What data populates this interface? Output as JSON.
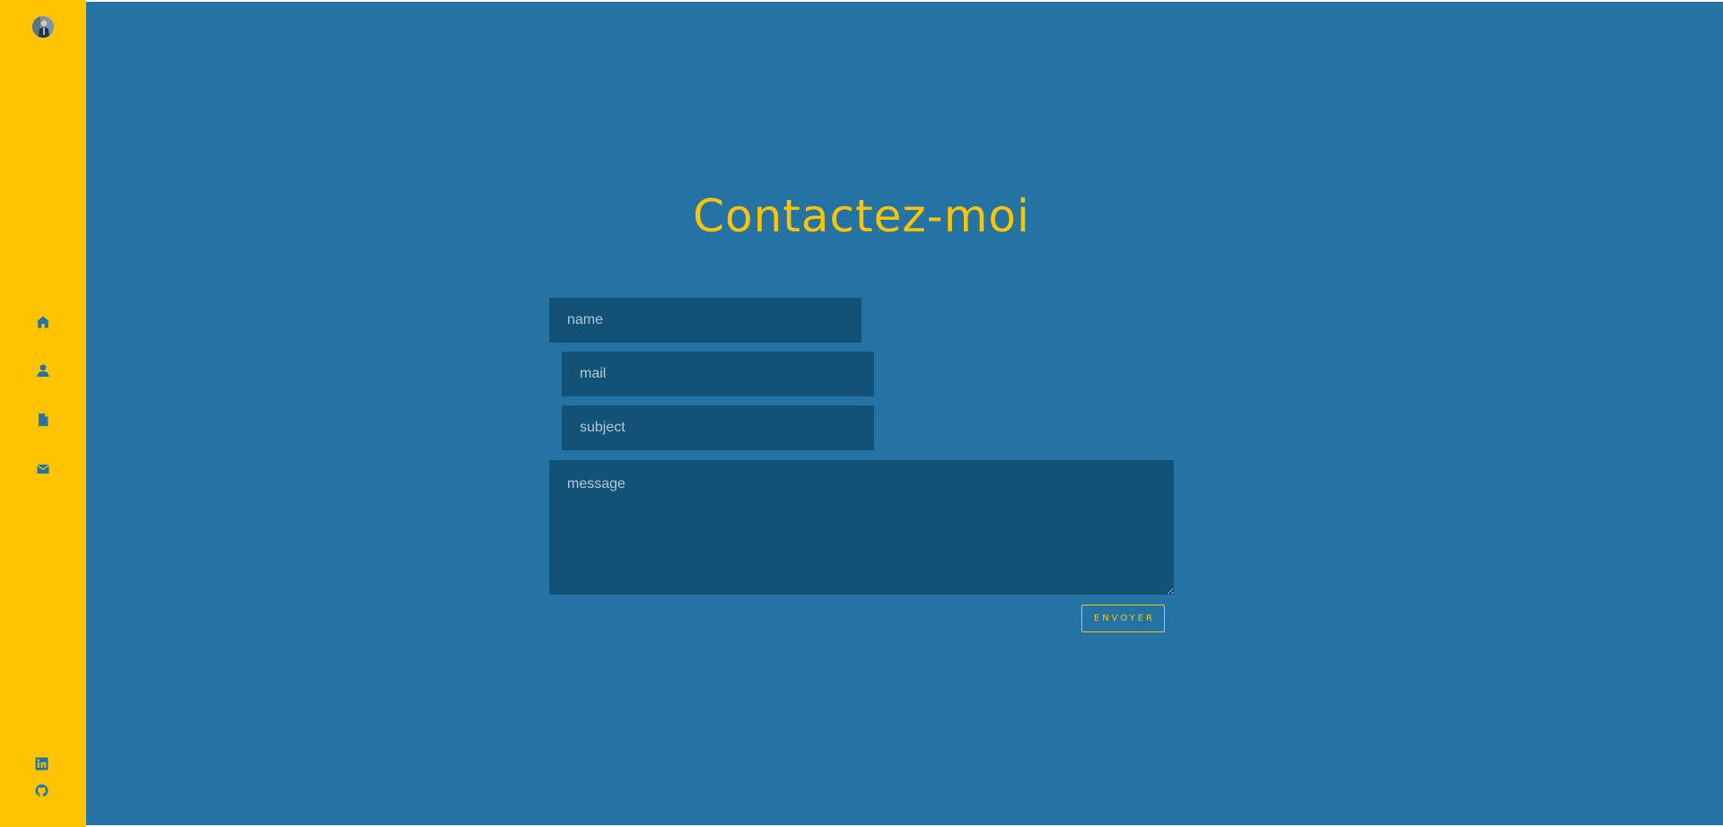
{
  "sidebar": {
    "avatar": "profile-photo",
    "nav": [
      {
        "name": "home",
        "icon": "home-icon"
      },
      {
        "name": "about",
        "icon": "user-icon"
      },
      {
        "name": "resume",
        "icon": "file-icon"
      },
      {
        "name": "contact",
        "icon": "envelope-icon"
      }
    ],
    "social": [
      {
        "name": "linkedin",
        "icon": "linkedin-icon"
      },
      {
        "name": "github",
        "icon": "github-icon"
      }
    ]
  },
  "main": {
    "title": "Contactez-moi",
    "form": {
      "name_placeholder": "name",
      "mail_placeholder": "mail",
      "subject_placeholder": "subject",
      "message_placeholder": "message",
      "send_label": "ENVOYER"
    }
  },
  "colors": {
    "sidebar_bg": "#ffc300",
    "main_bg": "#2374a5",
    "field_bg": "#125277",
    "accent": "#ffc300"
  }
}
